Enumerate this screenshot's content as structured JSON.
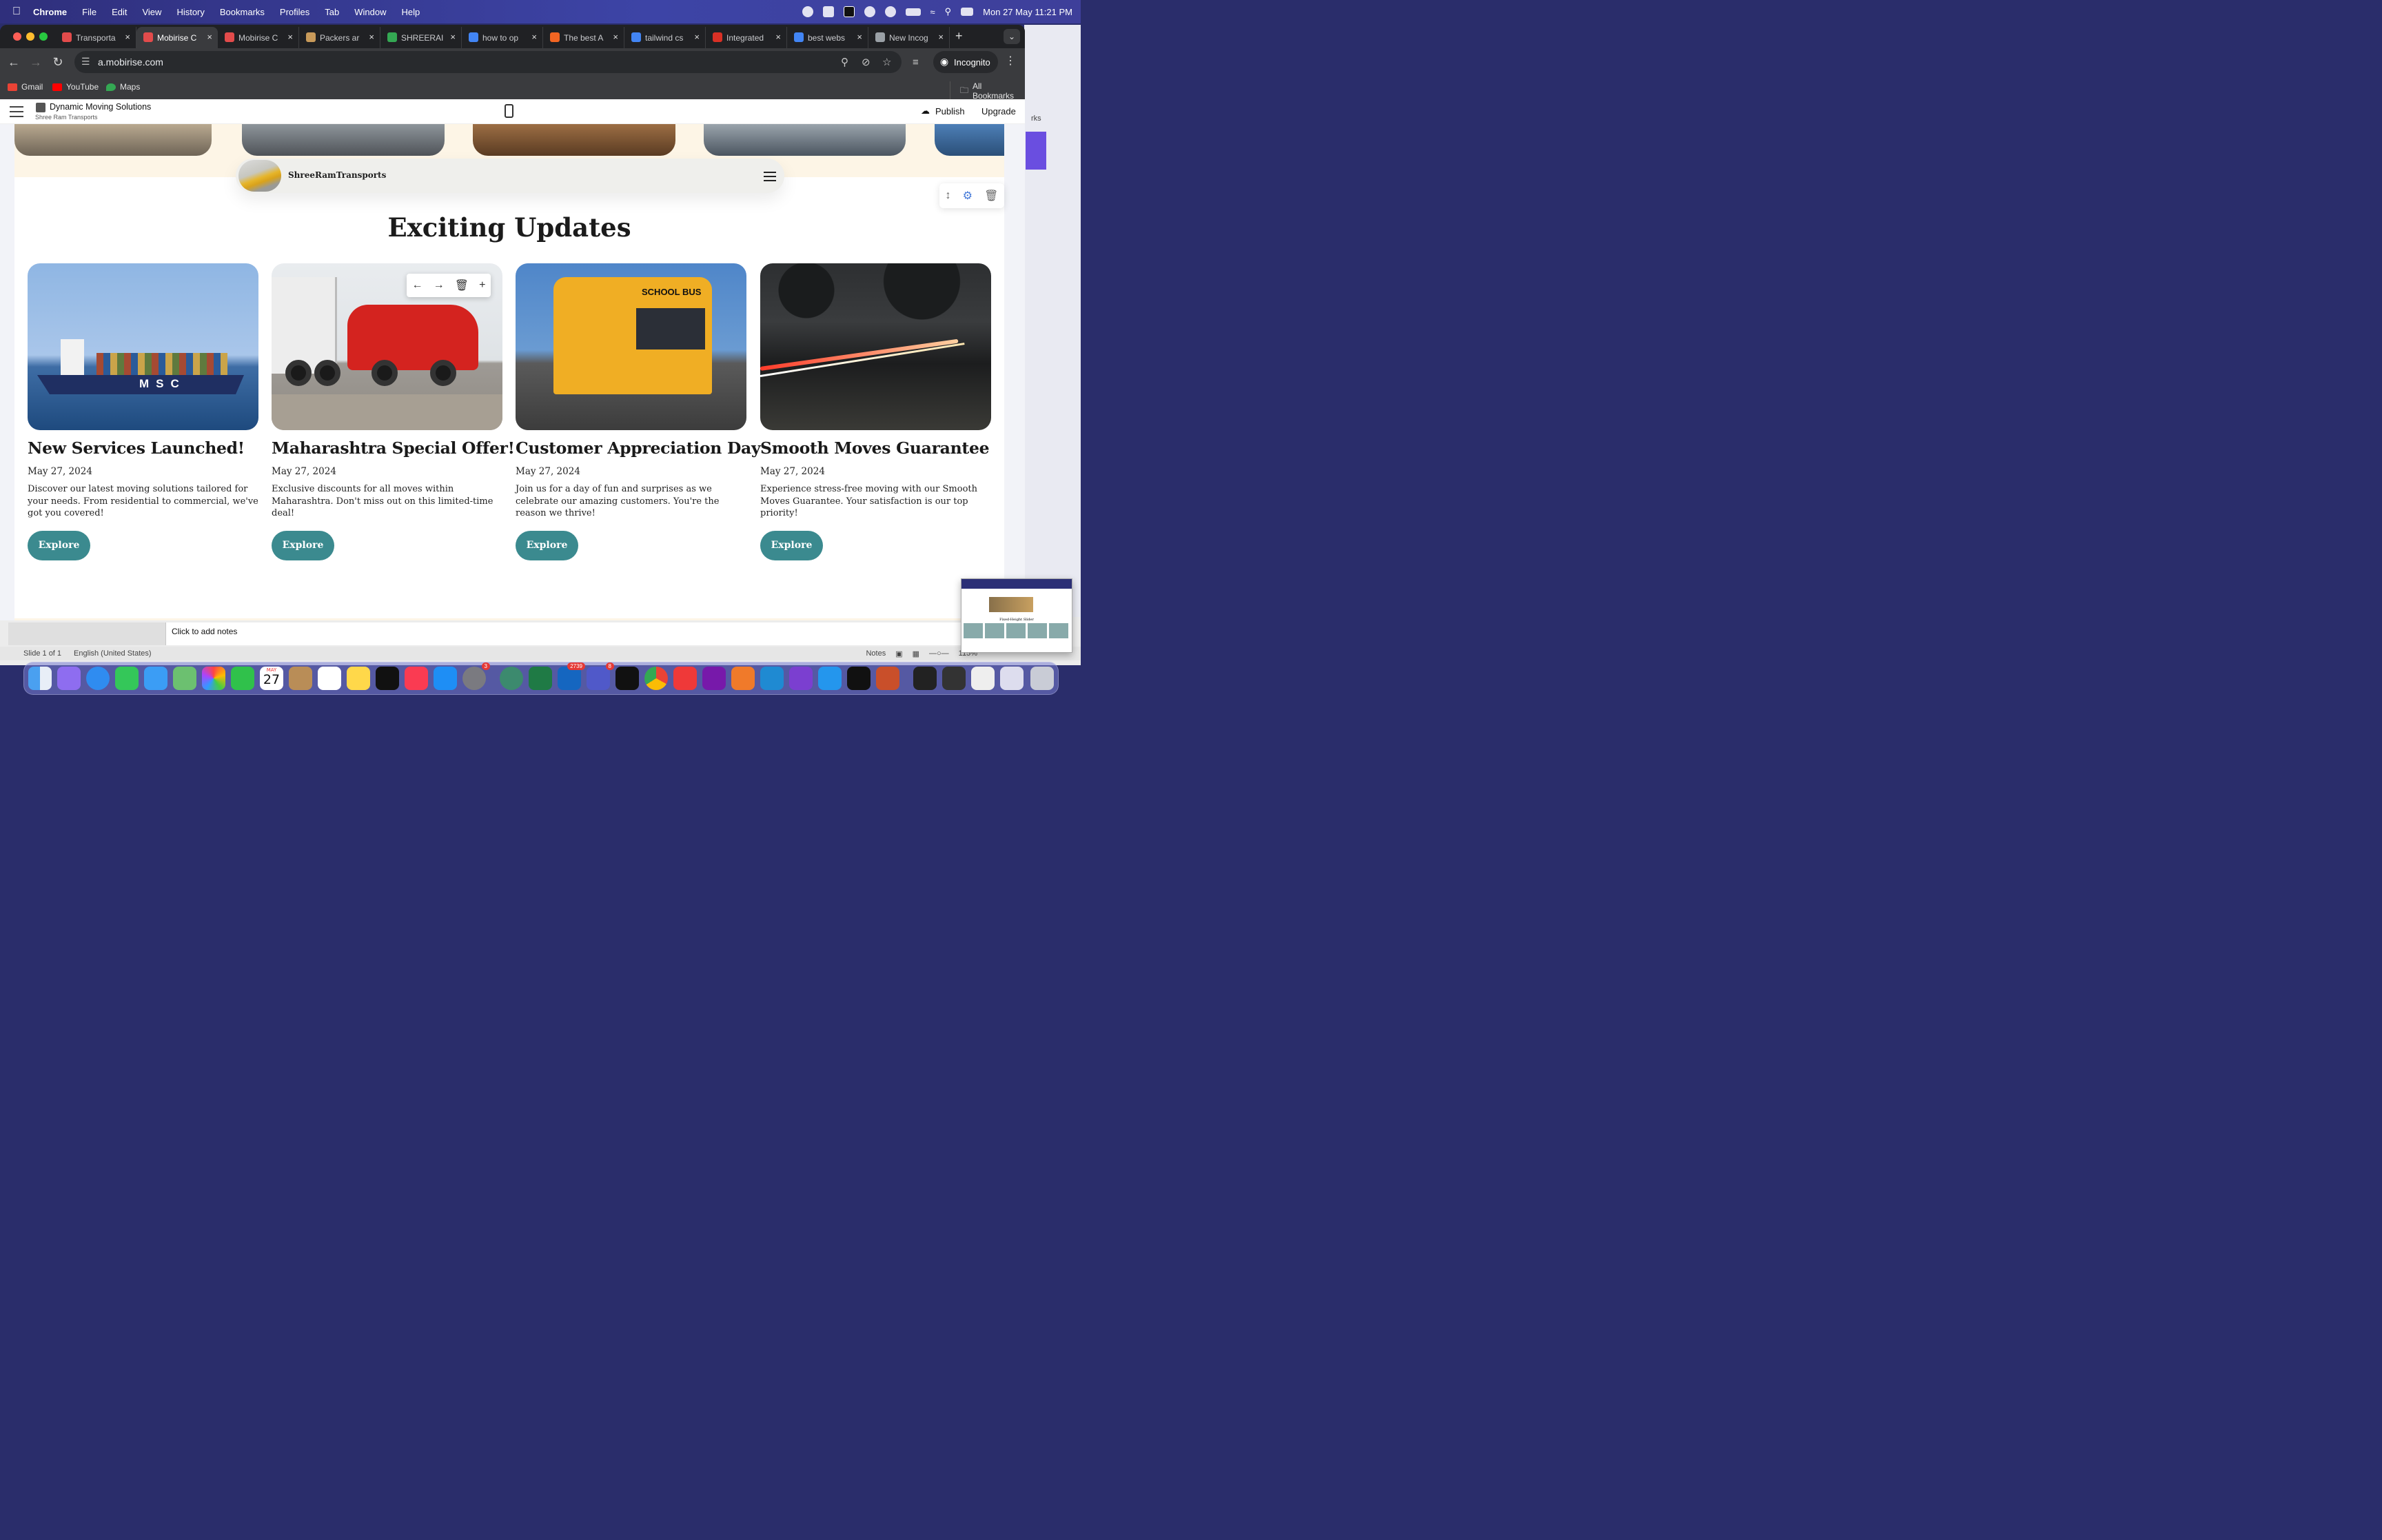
{
  "menubar": {
    "app": "Chrome",
    "items": [
      "File",
      "Edit",
      "View",
      "History",
      "Bookmarks",
      "Profiles",
      "Tab",
      "Window",
      "Help"
    ],
    "datetime": "Mon 27 May  11:21 PM"
  },
  "tabs": [
    {
      "title": "Transporta",
      "color": "#e24b4b"
    },
    {
      "title": "Mobirise C",
      "color": "#e24b4b"
    },
    {
      "title": "Mobirise C",
      "color": "#e24b4b"
    },
    {
      "title": "Packers ar",
      "color": "#c89a5a"
    },
    {
      "title": "SHREERAI",
      "color": "#34a853"
    },
    {
      "title": "how to op",
      "color": "#4285f4"
    },
    {
      "title": "The best A",
      "color": "#f26522"
    },
    {
      "title": "tailwind cs",
      "color": "#4285f4"
    },
    {
      "title": "Integrated",
      "color": "#d93025"
    },
    {
      "title": "best webs",
      "color": "#4285f4"
    },
    {
      "title": "New Incog",
      "color": "#9aa0a6"
    }
  ],
  "active_tab_index": 1,
  "toolbar": {
    "url": "a.mobirise.com",
    "incognito_label": "Incognito"
  },
  "bookmarks": {
    "items": [
      "Gmail",
      "YouTube",
      "Maps"
    ],
    "all": "All Bookmarks"
  },
  "editor": {
    "site_name": "Dynamic Moving Solutions",
    "site_sub": "Shree Ram Transports",
    "publish": "Publish",
    "upgrade": "Upgrade"
  },
  "site": {
    "brand": "ShreeRamTransports",
    "heading": "Exciting Updates",
    "cards": [
      {
        "title": "New Services Launched!",
        "date": "May 27, 2024",
        "desc": "Discover our latest moving solutions tailored for your needs. From residential to commercial, we've got you covered!",
        "button": "Explore",
        "image": "container-ship"
      },
      {
        "title": "Maharashtra Special Offer!",
        "date": "May 27, 2024",
        "desc": "Exclusive discounts for all moves within Maharashtra. Don't miss out on this limited-time deal!",
        "button": "Explore",
        "image": "red-truck"
      },
      {
        "title": "Customer Appreciation Day",
        "date": "May 27, 2024",
        "desc": "Join us for a day of fun and surprises as we celebrate our amazing customers. You're the reason we thrive!",
        "button": "Explore",
        "image": "school-bus"
      },
      {
        "title": "Smooth Moves Guarantee",
        "date": "May 27, 2024",
        "desc": "Experience stress-free moving with our Smooth Moves Guarantee. Your satisfaction is our top priority!",
        "button": "Explore",
        "image": "night-road"
      }
    ],
    "ship_text": "MSC",
    "bus_text": "SCHOOL BUS"
  },
  "background_app": {
    "notes_placeholder": "Click to add notes",
    "slide": "Slide 1 of 1",
    "language": "English (United States)",
    "notes_btn": "Notes",
    "zoom": "115%",
    "side_text": "rks"
  },
  "thumbnail": {
    "title": "Fixed-Height Slider"
  },
  "dock": {
    "calendar_month": "MAY",
    "calendar_day": "27",
    "badges": {
      "settings": "3",
      "outlook": "2739",
      "teams": "8"
    }
  },
  "colors": {
    "accent": "#3b8a8f",
    "band": "#fdf5e6",
    "menubar": "#3d44a6"
  }
}
